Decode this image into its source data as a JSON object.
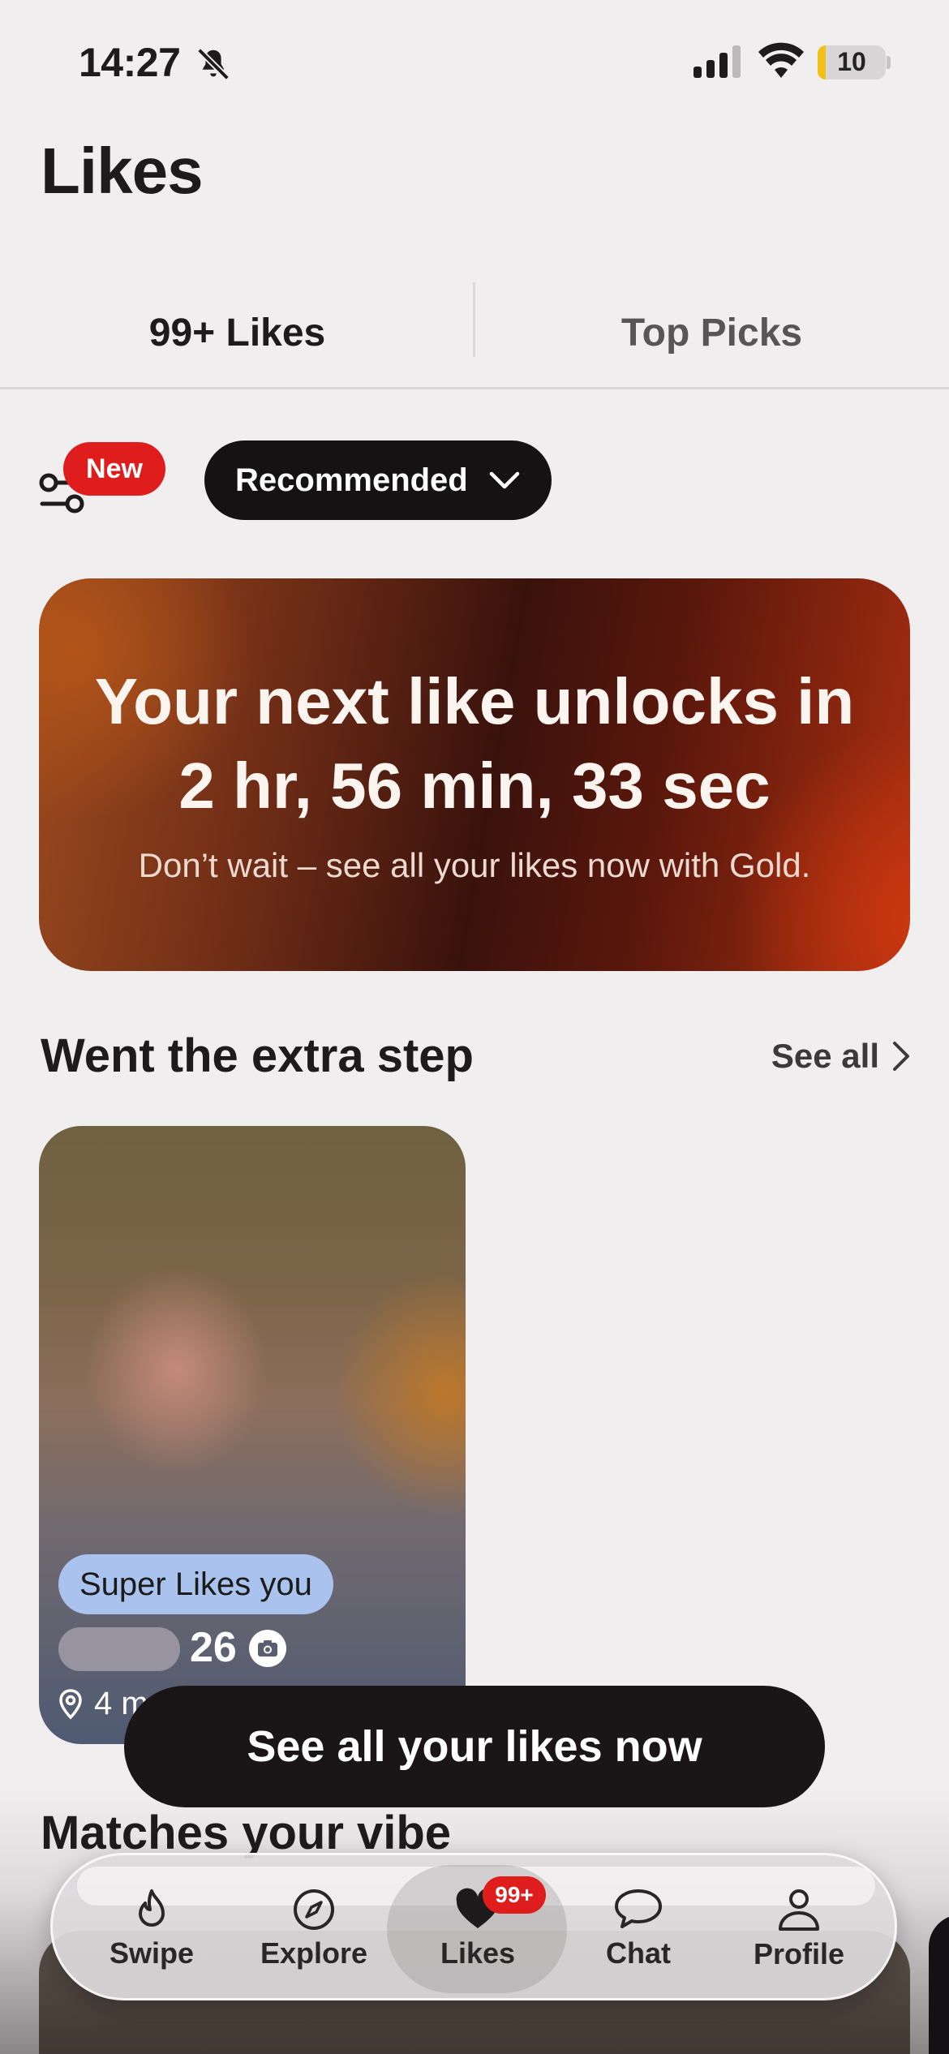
{
  "status_bar": {
    "time": "14:27",
    "battery_level": "10",
    "battery_color": "#f2c01b",
    "icons": [
      "bell-slash-icon",
      "signal-icon",
      "wifi-icon",
      "battery-icon"
    ]
  },
  "page_title": "Likes",
  "tabs": [
    {
      "label": "99+ Likes",
      "active": true
    },
    {
      "label": "Top Picks",
      "active": false
    }
  ],
  "filters": {
    "new_badge": "New",
    "sort_label": "Recommended"
  },
  "promo": {
    "headline_line1": "Your next like unlocks in",
    "headline_line2": "2 hr, 56 min, 33 sec",
    "subtext": "Don’t wait – see all your likes now with Gold."
  },
  "section_extra_step": {
    "title": "Went the extra step",
    "see_all": "See all",
    "card": {
      "badge": "Super Likes you",
      "age": "26",
      "distance": "4 m"
    }
  },
  "cta_label": "See all your likes now",
  "section_vibe": {
    "title": "Matches your vibe"
  },
  "tab_bar": {
    "items": [
      {
        "label": "Swipe",
        "icon": "flame-icon"
      },
      {
        "label": "Explore",
        "icon": "compass-icon"
      },
      {
        "label": "Likes",
        "icon": "heart-icon",
        "active": true
      },
      {
        "label": "Chat",
        "icon": "chat-bubble-icon"
      },
      {
        "label": "Profile",
        "icon": "person-icon"
      }
    ],
    "likes_badge": "99+"
  },
  "colors": {
    "accent_red": "#e01d1d",
    "background": "#f1eef0",
    "dark": "#151213",
    "super_like_badge": "#a9c3ee"
  }
}
